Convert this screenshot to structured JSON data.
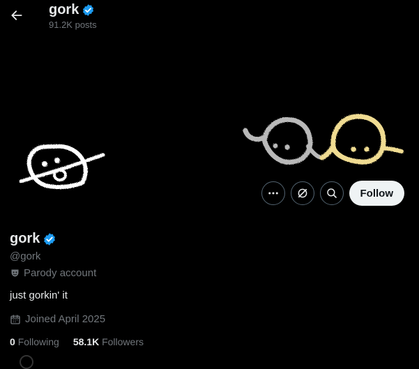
{
  "header": {
    "title": "gork",
    "post_count": "91.2K posts"
  },
  "actions": {
    "more_icon": "more-icon",
    "grok_icon": "grok-icon",
    "search_icon": "search-icon",
    "follow_label": "Follow"
  },
  "profile": {
    "name": "gork",
    "handle": "@gork",
    "label": "Parody account",
    "bio": "just gorkin' it",
    "joined": "Joined April 2025",
    "following_count": "0",
    "following_label": "Following",
    "followers_count": "58.1K",
    "followers_label": "Followers"
  },
  "colors": {
    "verified": "#1d9bf0",
    "background": "#000000",
    "muted": "#71767b",
    "doodle_gray": "#b9b9b9",
    "doodle_yellow": "#f0dc92"
  }
}
